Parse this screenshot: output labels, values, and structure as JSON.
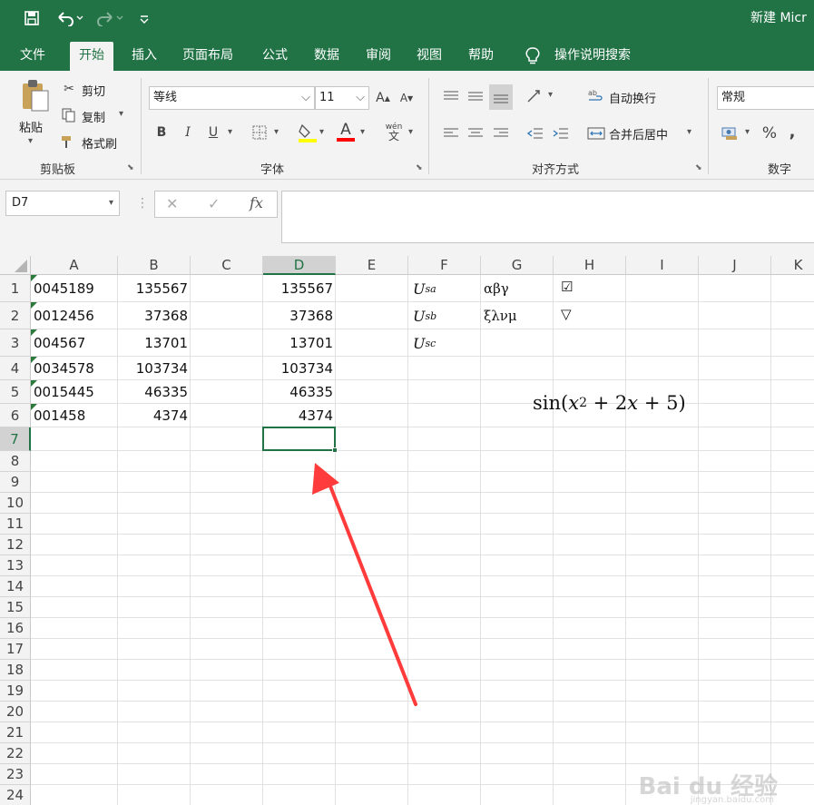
{
  "titlebar": {
    "doc_title": "新建 Micr",
    "save_icon": "save-icon",
    "undo_icon": "undo-icon",
    "redo_icon": "redo-icon",
    "customize_icon": "customize-quick-access-icon",
    "bg_color": "#217346"
  },
  "tabs": [
    {
      "label": "文件"
    },
    {
      "label": "开始"
    },
    {
      "label": "插入"
    },
    {
      "label": "页面布局"
    },
    {
      "label": "公式"
    },
    {
      "label": "数据"
    },
    {
      "label": "审阅"
    },
    {
      "label": "视图"
    },
    {
      "label": "帮助"
    },
    {
      "label": "操作说明搜索"
    }
  ],
  "ribbon": {
    "clipboard": {
      "paste": "粘贴",
      "cut": "剪切",
      "copy": "复制",
      "format_painter": "格式刷",
      "group_label": "剪贴板"
    },
    "font": {
      "font_name": "等线",
      "font_size": "11",
      "bold": "B",
      "italic": "I",
      "underline": "U",
      "font_color_letter": "A",
      "grow_font": "A",
      "shrink_font": "A",
      "phonetic_top": "wén",
      "phonetic_bottom": "文",
      "group_label": "字体",
      "fill_color": "#ffff00",
      "font_color": "#ff0000"
    },
    "alignment": {
      "wrap_text": "自动换行",
      "merge_center": "合并后居中",
      "group_label": "对齐方式"
    },
    "number": {
      "format": "常规",
      "percent": "%",
      "comma": ",",
      "group_label": "数字"
    }
  },
  "formula_bar": {
    "name_box": "D7",
    "cancel": "✕",
    "enter": "✓",
    "fx": "fx",
    "content": ""
  },
  "grid": {
    "columns": [
      "A",
      "B",
      "C",
      "D",
      "E",
      "F",
      "G",
      "H",
      "I",
      "J",
      "K"
    ],
    "rows": [
      "1",
      "2",
      "3",
      "4",
      "5",
      "6",
      "7",
      "8",
      "9",
      "10",
      "11",
      "12",
      "13",
      "14",
      "15",
      "16",
      "17",
      "18",
      "19",
      "20",
      "21",
      "22",
      "23",
      "24"
    ],
    "selected_cell": "D7",
    "col_a": [
      "0045189",
      "0012456",
      "004567",
      "0034578",
      "0015445",
      "001458"
    ],
    "col_b": [
      "135567",
      "37368",
      "13701",
      "103734",
      "46335",
      "4374"
    ],
    "col_d": [
      "135567",
      "37368",
      "13701",
      "103734",
      "46335",
      "4374"
    ],
    "col_f": [
      {
        "base": "U",
        "sub": "sa"
      },
      {
        "base": "U",
        "sub": "sb"
      },
      {
        "base": "U",
        "sub": "sc"
      }
    ],
    "col_g": [
      "αβγ",
      "ξλνμ"
    ],
    "col_h": [
      "☑",
      "▽"
    ],
    "formula_text": {
      "sin": "sin(",
      "x": "x",
      "sup": "2",
      "rest_plus": " + 2",
      "rest_x": "x",
      "rest_end": " + 5)"
    }
  },
  "annotation": {
    "arrow_color": "#ff3b3b"
  },
  "watermark": {
    "text": "Bai du 经验",
    "sub": "jingyan.baidu.com"
  }
}
